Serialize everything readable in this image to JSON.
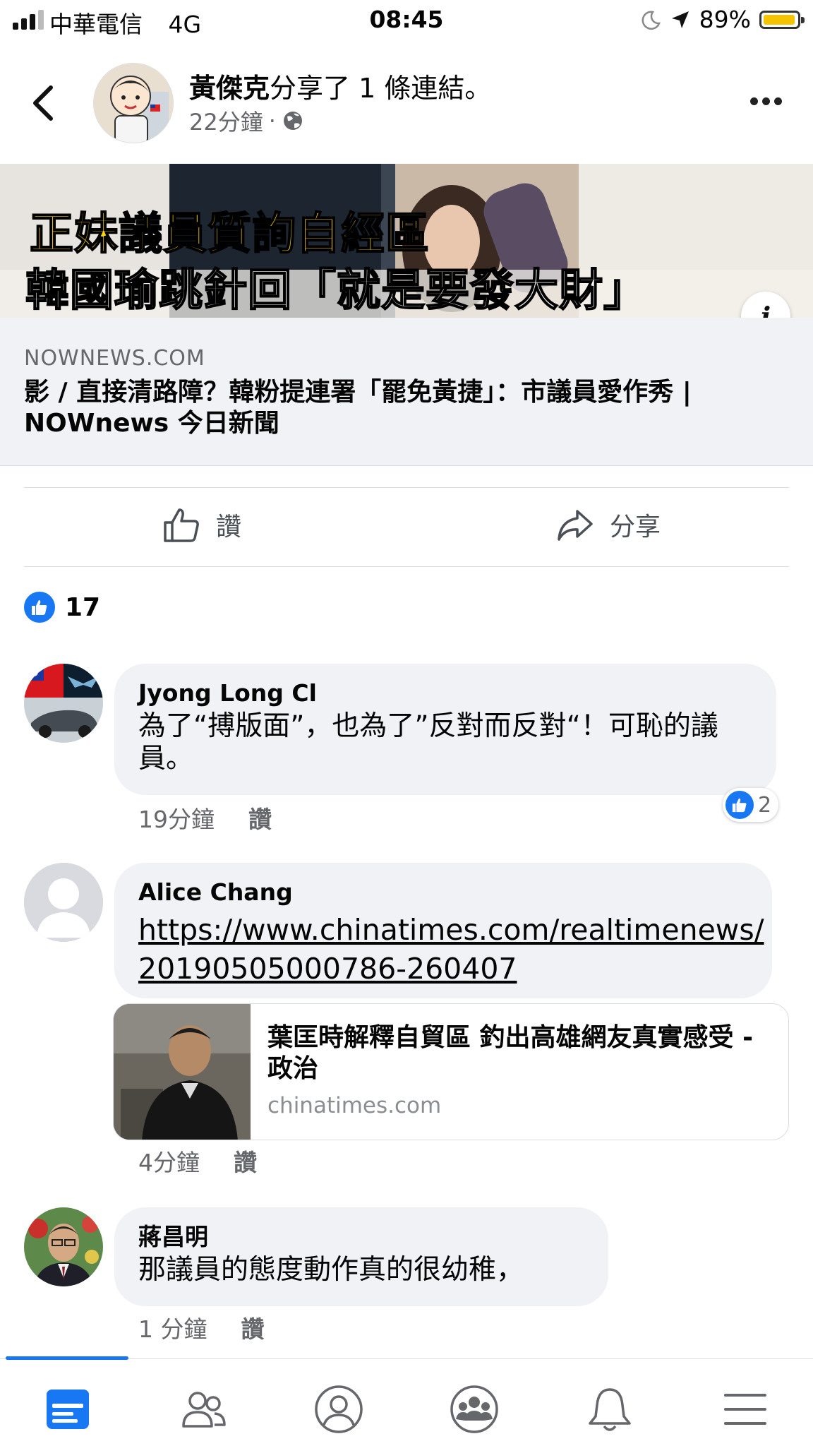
{
  "status_bar": {
    "carrier": "中華電信",
    "network": "4G",
    "time": "08:45",
    "battery": "89%",
    "battery_color": "#f5c400"
  },
  "header": {
    "back_icon": "chevron-left-icon",
    "author": "黃傑克",
    "action": "分享了 1 條連結。",
    "time": "22分鐘",
    "dot": "·",
    "audience_icon": "globe-icon",
    "more_icon": "more-icon"
  },
  "link_preview": {
    "banner_line1": "正妹議員質詢自經區",
    "banner_line2": "韓國瑜跳針回「就是要發大財」",
    "domain": "NOWNEWS.COM",
    "title": "影 / 直接清路障？韓粉提連署「罷免黃捷」：市議員愛作秀 | NOWnews 今日新聞"
  },
  "actions": {
    "like_label": "讚",
    "share_label": "分享"
  },
  "reactions": {
    "count": "17",
    "accent": "#1877f2"
  },
  "comments": [
    {
      "name": "Jyong Long Cl",
      "text": "為了“搏版面”，也為了”反對而反對“！可恥的議員。",
      "time": "19分鐘",
      "like": "讚",
      "reaction_count": "2"
    },
    {
      "name": "Alice Chang",
      "link": "https://www.chinatimes.com/realtimenews/20190505000786-260407",
      "link_line1": "https://www.chinatimes.com/realtimenews/",
      "link_line2": "20190505000786-260407",
      "time": "4分鐘",
      "like": "讚",
      "preview": {
        "title": "葉匡時解釋自貿區 釣出高雄網友真實感受 - 政治",
        "domain": "chinatimes.com"
      }
    },
    {
      "name": "蔣昌明",
      "text": "那議員的態度動作真的很幼稚，",
      "time": "1 分鐘",
      "like": "讚"
    }
  ],
  "tab_bar": {
    "tabs": [
      "news-feed-icon",
      "friends-icon",
      "profile-icon",
      "groups-icon",
      "notifications-icon",
      "menu-icon"
    ],
    "active_color": "#1877f2"
  }
}
